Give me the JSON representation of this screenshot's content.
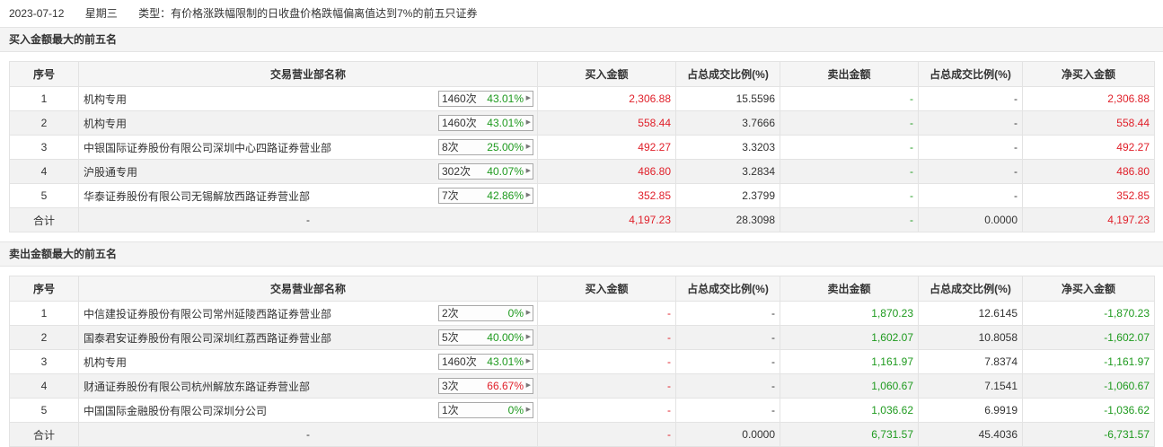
{
  "header": {
    "date": "2023-07-12",
    "weekday": "星期三",
    "type_text": "类型：有价格涨跌幅限制的日收盘价格跌幅偏离值达到7%的前五只证券"
  },
  "columns": {
    "seq": "序号",
    "dept": "交易营业部名称",
    "buy": "买入金额",
    "buy_ratio": "占总成交比例(%)",
    "sell": "卖出金额",
    "sell_ratio": "占总成交比例(%)",
    "net": "净买入金额"
  },
  "buy_section": {
    "title": "买入金额最大的前五名",
    "rows": [
      {
        "seq": "1",
        "name": "机构专用",
        "count": "1460次",
        "rate": "43.01%",
        "buy": "2,306.88",
        "buy_ratio": "15.5596",
        "sell": "-",
        "sell_ratio": "-",
        "net": "2,306.88"
      },
      {
        "seq": "2",
        "name": "机构专用",
        "count": "1460次",
        "rate": "43.01%",
        "buy": "558.44",
        "buy_ratio": "3.7666",
        "sell": "-",
        "sell_ratio": "-",
        "net": "558.44"
      },
      {
        "seq": "3",
        "name": "中银国际证券股份有限公司深圳中心四路证券营业部",
        "count": "8次",
        "rate": "25.00%",
        "buy": "492.27",
        "buy_ratio": "3.3203",
        "sell": "-",
        "sell_ratio": "-",
        "net": "492.27"
      },
      {
        "seq": "4",
        "name": "沪股通专用",
        "count": "302次",
        "rate": "40.07%",
        "buy": "486.80",
        "buy_ratio": "3.2834",
        "sell": "-",
        "sell_ratio": "-",
        "net": "486.80"
      },
      {
        "seq": "5",
        "name": "华泰证券股份有限公司无锡解放西路证券营业部",
        "count": "7次",
        "rate": "42.86%",
        "buy": "352.85",
        "buy_ratio": "2.3799",
        "sell": "-",
        "sell_ratio": "-",
        "net": "352.85"
      }
    ],
    "total": {
      "label": "合计",
      "name": "-",
      "buy": "4,197.23",
      "buy_ratio": "28.3098",
      "sell": "-",
      "sell_ratio": "0.0000",
      "net": "4,197.23"
    }
  },
  "sell_section": {
    "title": "卖出金额最大的前五名",
    "rows": [
      {
        "seq": "1",
        "name": "中信建投证券股份有限公司常州延陵西路证券营业部",
        "count": "2次",
        "rate": "0%",
        "buy": "-",
        "buy_ratio": "-",
        "sell": "1,870.23",
        "sell_ratio": "12.6145",
        "net": "-1,870.23"
      },
      {
        "seq": "2",
        "name": "国泰君安证券股份有限公司深圳红荔西路证券营业部",
        "count": "5次",
        "rate": "40.00%",
        "buy": "-",
        "buy_ratio": "-",
        "sell": "1,602.07",
        "sell_ratio": "10.8058",
        "net": "-1,602.07"
      },
      {
        "seq": "3",
        "name": "机构专用",
        "count": "1460次",
        "rate": "43.01%",
        "buy": "-",
        "buy_ratio": "-",
        "sell": "1,161.97",
        "sell_ratio": "7.8374",
        "net": "-1,161.97"
      },
      {
        "seq": "4",
        "name": "财通证券股份有限公司杭州解放东路证券营业部",
        "count": "3次",
        "rate": "66.67%",
        "buy": "-",
        "buy_ratio": "-",
        "sell": "1,060.67",
        "sell_ratio": "7.1541",
        "net": "-1,060.67"
      },
      {
        "seq": "5",
        "name": "中国国际金融股份有限公司深圳分公司",
        "count": "1次",
        "rate": "0%",
        "buy": "-",
        "buy_ratio": "-",
        "sell": "1,036.62",
        "sell_ratio": "6.9919",
        "net": "-1,036.62"
      }
    ],
    "total": {
      "label": "合计",
      "name": "-",
      "buy": "-",
      "buy_ratio": "0.0000",
      "sell": "6,731.57",
      "sell_ratio": "45.4036",
      "net": "-6,731.57"
    }
  },
  "colors": {
    "up": "#e0202a",
    "down": "#1e9a1e",
    "rate_high": "#e0202a",
    "rate_normal": "#1e9a1e"
  },
  "icons": {
    "badge_arrow": "caret-right-icon"
  }
}
